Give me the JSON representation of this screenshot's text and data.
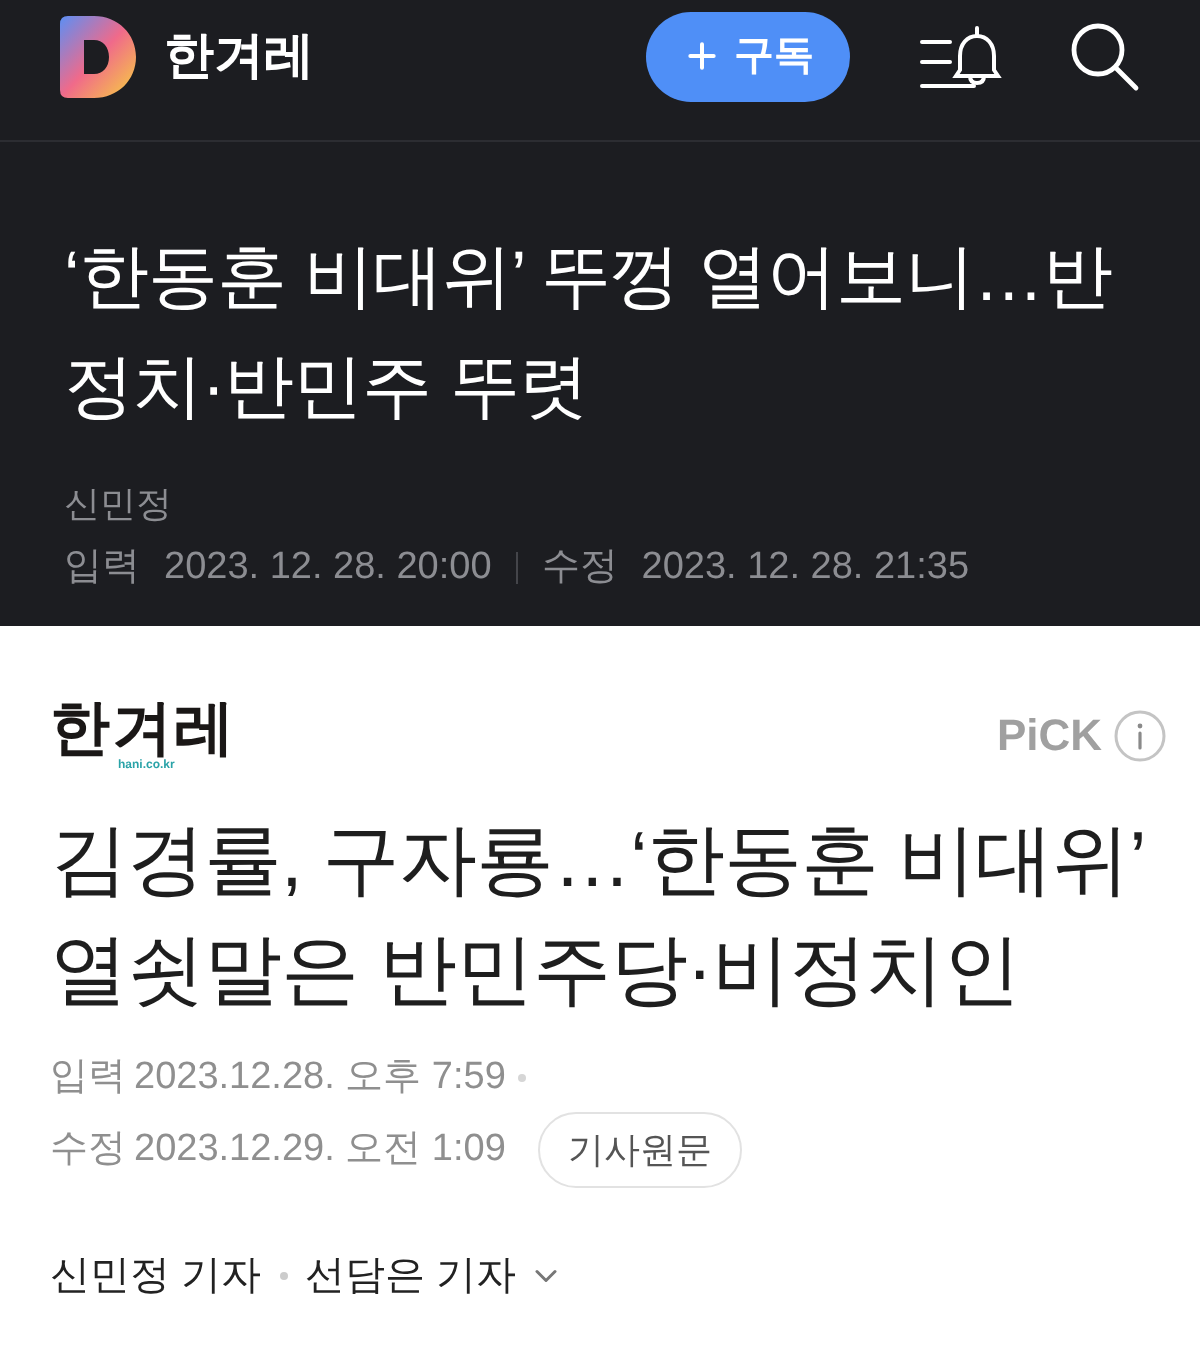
{
  "header": {
    "brand": "한겨레",
    "subscribe": "구독"
  },
  "dark_article": {
    "title": "‘한동훈 비대위’ 뚜껑 열어보니…반정치·반민주 뚜렷",
    "author": "신민정",
    "dates": [
      {
        "label": "입력",
        "value": "2023. 12. 28. 20:00"
      },
      {
        "label": "수정",
        "value": "2023. 12. 28. 21:35"
      }
    ]
  },
  "news_card": {
    "press_logo": "한겨레",
    "press_domain": "hani.co.kr",
    "badge": "PiCK",
    "title": "김경률, 구자룡…‘한동훈 비대위’ 열쇳말은 반민주당·비정치인",
    "dates": [
      {
        "label": "입력",
        "value": "2023.12.28. 오후 7:59"
      },
      {
        "label": "수정",
        "value": "2023.12.29. 오전 1:09"
      }
    ],
    "original_button": "기사원문",
    "reporters": [
      "신민정 기자",
      "선담은 기자"
    ]
  }
}
